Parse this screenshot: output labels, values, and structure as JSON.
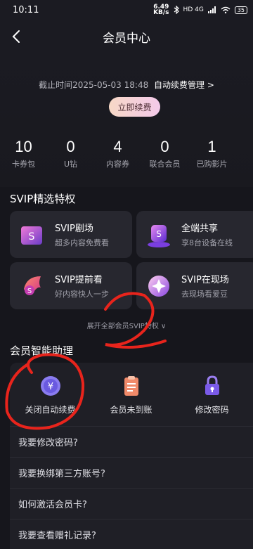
{
  "status_bar": {
    "time": "10:11",
    "speed_value": "6.49",
    "speed_unit": "KB/s",
    "network": "HD 4G",
    "battery": "35"
  },
  "nav": {
    "title": "会员中心"
  },
  "membership": {
    "expire_text": "截止时间2025-05-03 18:48",
    "auto_renew_manage": "自动续费管理 >",
    "renew_button": "立即续费"
  },
  "stats": [
    {
      "num": "10",
      "label": "卡券包"
    },
    {
      "num": "0",
      "label": "U钻"
    },
    {
      "num": "4",
      "label": "内容券"
    },
    {
      "num": "0",
      "label": "联合会员"
    },
    {
      "num": "1",
      "label": "已购影片"
    }
  ],
  "privileges": {
    "title": "SVIP精选特权",
    "items": [
      {
        "name": "SVIP剧场",
        "desc": "超多内容免费看"
      },
      {
        "name": "全端共享",
        "desc": "享8台设备在线"
      },
      {
        "name": "SVIP提前看",
        "desc": "好内容快人一步"
      },
      {
        "name": "SVIP在现场",
        "desc": "去现场看爱豆"
      }
    ],
    "expand_text": "展开全部会员SVIP特权 ∨"
  },
  "assistant": {
    "title": "会员智能助理",
    "items": [
      {
        "label": "关闭自动续费",
        "icon": "yuan-coin-icon"
      },
      {
        "label": "会员未到账",
        "icon": "clipboard-icon"
      },
      {
        "label": "修改密码",
        "icon": "lock-icon"
      }
    ],
    "faq": [
      "我要修改密码?",
      "我要换绑第三方账号?",
      "如何激活会员卡?",
      "我要查看赠礼记录?"
    ]
  },
  "colors": {
    "background": "#16161c",
    "card": "#27272f",
    "annotation_red": "#e8241c",
    "renew_gradient_start": "#f7d8c6",
    "renew_gradient_end": "#f3c9ea"
  }
}
